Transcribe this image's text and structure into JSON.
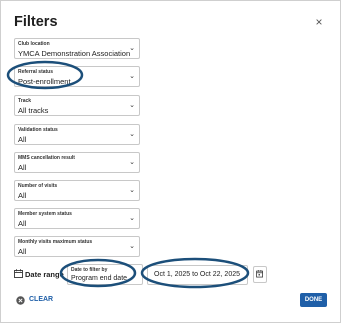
{
  "dialog": {
    "title": "Filters",
    "close_glyph": "×"
  },
  "fields": [
    {
      "label": "Club location",
      "value": "YMCA Demonstration Association"
    },
    {
      "label": "Referral status",
      "value": "Post-enrollment"
    },
    {
      "label": "Track",
      "value": "All tracks"
    },
    {
      "label": "Validation status",
      "value": "All"
    },
    {
      "label": "MMS cancellation result",
      "value": "All"
    },
    {
      "label": "Number of visits",
      "value": "All"
    },
    {
      "label": "Member system status",
      "value": "All"
    },
    {
      "label": "Monthly visits maximum status",
      "value": "All"
    }
  ],
  "date_filter": {
    "label": "Date range",
    "filter_by_label": "Date to filter by",
    "filter_by_value": "Program end date",
    "range_value": "Oct 1, 2025 to Oct 22, 2025"
  },
  "footer": {
    "clear_label": "CLEAR",
    "done_label": "DONE"
  },
  "colors": {
    "accent": "#1f5fa8",
    "annotation": "#1c4f7a"
  },
  "icons": {
    "close": "close-icon",
    "calendar": "calendar-icon",
    "clear": "clear-icon",
    "chevron": "chevron-down-icon"
  }
}
